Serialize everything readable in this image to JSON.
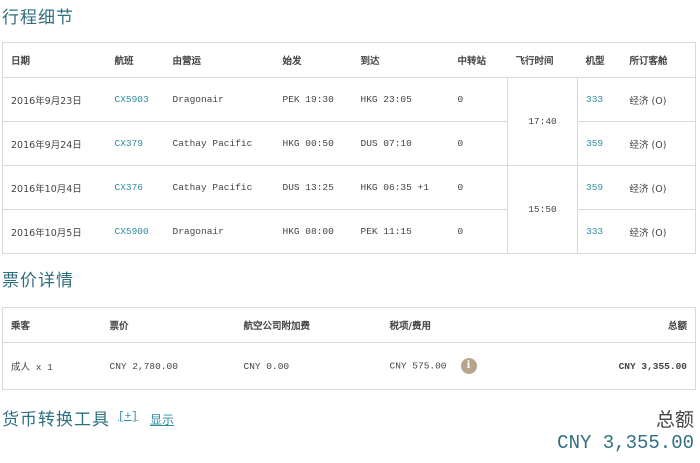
{
  "itinerary": {
    "title": "行程细节",
    "headers": {
      "date": "日期",
      "flight": "航班",
      "operator": "由营运",
      "depart": "始发",
      "arrive": "到达",
      "stops": "中转站",
      "duration": "飞行时间",
      "aircraft": "机型",
      "cabin": "所订客舱"
    },
    "rows": [
      {
        "date": "2016年9月23日",
        "flight": "CX5903",
        "operator": "Dragonair",
        "depart": "PEK 19:30",
        "arrive": "HKG 23:05",
        "stops": "0",
        "aircraft": "333",
        "cabin": "经济 (O)"
      },
      {
        "date": "2016年9月24日",
        "flight": "CX379",
        "operator": "Cathay Pacific",
        "depart": "HKG 00:50",
        "arrive": "DUS 07:10",
        "stops": "0",
        "aircraft": "359",
        "cabin": "经济 (O)"
      },
      {
        "date": "2016年10月4日",
        "flight": "CX376",
        "operator": "Cathay Pacific",
        "depart": "DUS 13:25",
        "arrive": "HKG 06:35 +1",
        "stops": "0",
        "aircraft": "359",
        "cabin": "经济 (O)"
      },
      {
        "date": "2016年10月5日",
        "flight": "CX5900",
        "operator": "Dragonair",
        "depart": "HKG 08:00",
        "arrive": "PEK 11:15",
        "stops": "0",
        "aircraft": "333",
        "cabin": "经济 (O)"
      }
    ],
    "durations": [
      "17:40",
      "15:50"
    ]
  },
  "fare": {
    "title": "票价详情",
    "headers": {
      "passenger": "乘客",
      "fare": "票价",
      "surcharge": "航空公司附加费",
      "taxes": "税项/费用",
      "total": "总额"
    },
    "row": {
      "passenger": "成人 x 1",
      "fare": "CNY 2,780.00",
      "surcharge": "CNY 0.00",
      "taxes": "CNY 575.00",
      "total": "CNY 3,355.00"
    },
    "info_icon": "info-icon"
  },
  "currency_tool": {
    "title": "货币转换工具",
    "toggle": "[+]",
    "show": "显示"
  },
  "summary": {
    "total_label": "总额",
    "total_value": "CNY 3,355.00"
  },
  "colors": {
    "accent": "#2f6f7f",
    "link": "#2b8c9d",
    "border": "#d9d9d9",
    "info_icon": "#b7a48a"
  }
}
